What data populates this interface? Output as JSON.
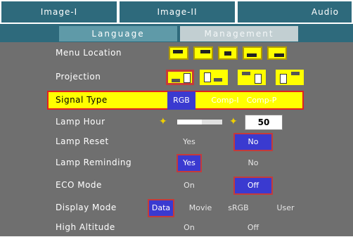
{
  "top_tabs": [
    {
      "label": "Image-I"
    },
    {
      "label": "Image-II"
    },
    {
      "label": "Audio"
    }
  ],
  "sub_tabs": [
    {
      "label": "Language",
      "active": false
    },
    {
      "label": "Management",
      "active": true
    }
  ],
  "menu": {
    "menu_location": {
      "label": "Menu Location",
      "icons": [
        "top-left-position-icon",
        "top-right-position-icon",
        "center-position-icon",
        "bottom-left-position-icon",
        "bottom-right-position-icon"
      ]
    },
    "projection": {
      "label": "Projection",
      "icons": [
        "front-desktop-icon",
        "rear-desktop-icon",
        "front-ceiling-icon",
        "rear-ceiling-icon"
      ],
      "selected": 0
    },
    "signal_type": {
      "label": "Signal Type",
      "options": [
        "RGB",
        "Comp-I",
        "Comp-P"
      ],
      "selected": "RGB"
    },
    "lamp_hour": {
      "label": "Lamp Hour",
      "value": "50",
      "level": 0.55
    },
    "lamp_reset": {
      "label": "Lamp Reset",
      "options": [
        "Yes",
        "No"
      ],
      "selected": "No"
    },
    "lamp_reminding": {
      "label": "Lamp Reminding",
      "options": [
        "Yes",
        "No"
      ],
      "selected": "Yes"
    },
    "eco_mode": {
      "label": "ECO Mode",
      "options": [
        "On",
        "Off"
      ],
      "selected": "Off"
    },
    "display_mode": {
      "label": "Display Mode",
      "options": [
        "Data",
        "Movie",
        "sRGB",
        "User"
      ],
      "selected": "Data"
    },
    "high_altitude": {
      "label": "High Altitude",
      "options": [
        "On",
        "Off"
      ],
      "selected": null
    }
  },
  "colors": {
    "highlight": "#ffff00",
    "selected": "#3a3ad0",
    "tab": "#2e6a7c",
    "panel": "#6f6f6f"
  }
}
